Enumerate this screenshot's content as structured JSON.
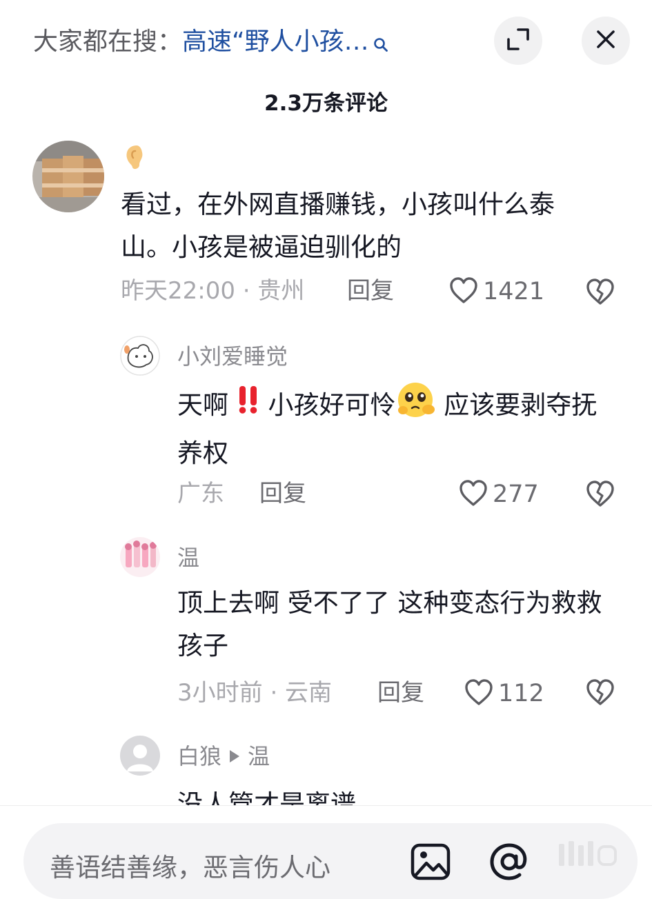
{
  "header": {
    "search_label": "大家都在搜：",
    "search_term": "高速“野人小孩…",
    "comment_count": "2.3万条评论"
  },
  "comments": [
    {
      "username": "",
      "text": "看过，在外网直播赚钱，小孩叫什么泰山。小孩是被逼迫驯化的",
      "time_location": "昨天22:00 · 贵州",
      "reply_label": "回复",
      "likes": "1421"
    },
    {
      "username": "小刘爱睡觉",
      "text_a": "天啊",
      "text_b": "小孩好可怜",
      "text_c": "应该要剥夺抚养权",
      "time_location": "广东",
      "reply_label": "回复",
      "likes": "277"
    },
    {
      "username": "温",
      "text": "顶上去啊 受不了了 这种变态行为救救孩子",
      "time_location": "3小时前 · 云南",
      "reply_label": "回复",
      "likes": "112"
    },
    {
      "username": "白狼",
      "reply_to": "温",
      "text": "没人管才是离谱"
    }
  ],
  "input": {
    "placeholder": "善语结善缘，恶言伤人心"
  },
  "colors": {
    "link": "#1f4fa0",
    "text": "#161823",
    "muted": "#a8a8ad",
    "icon": "#5c5c61",
    "accent_red": "#e8222d"
  },
  "icons": [
    "search-icon",
    "collapse-icon",
    "close-icon",
    "ear-emoji-icon",
    "heart-icon",
    "dislike-icon",
    "double-exclamation-icon",
    "pleading-face-icon",
    "play-arrow-icon",
    "image-icon",
    "at-icon"
  ]
}
